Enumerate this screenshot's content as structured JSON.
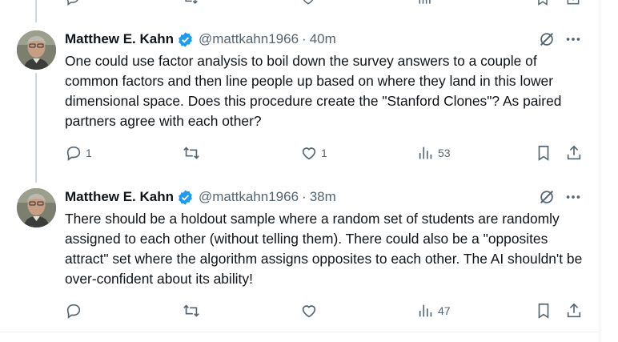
{
  "tweets": [
    {
      "author": "Matthew E. Kahn",
      "handle": "@mattkahn1966",
      "separator": "·",
      "time": "40m",
      "text": "One could use factor analysis to boil down the survey answers to a couple of common factors and then line people up based on where they land in this lower dimensional space.  Does this procedure create the \"Stanford Clones\"?  As paired partners agree with each other?",
      "replies": "1",
      "reposts": "",
      "likes": "1",
      "views": "53"
    },
    {
      "author": "Matthew E. Kahn",
      "handle": "@mattkahn1966",
      "separator": "·",
      "time": "38m",
      "text": "There should be a holdout sample where a random set of students are randomly assigned to each other (without telling them).  There could also be a \"opposites attract\" set where the algorithm assigns opposites to each other.  The AI shouldn't be over-confident about its ability!",
      "replies": "",
      "reposts": "",
      "likes": "",
      "views": "47"
    }
  ],
  "colors": {
    "verified": "#1d9bf0",
    "muted": "#536471",
    "text": "#0f1419",
    "thread_line": "#cfd9de"
  },
  "icons": [
    "reply-icon",
    "repost-icon",
    "like-icon",
    "views-icon",
    "bookmark-icon",
    "share-icon",
    "grok-icon",
    "more-icon",
    "verified-badge-icon"
  ]
}
